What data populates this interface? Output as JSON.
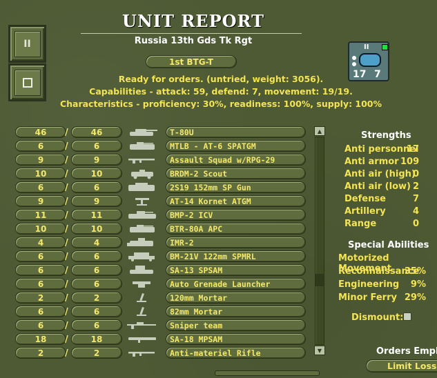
{
  "title": "UNIT REPORT",
  "subtitle": "Russia 13th Gds Tk Rgt",
  "btg_label": "1st BTG-T",
  "status_line": "Ready for orders. (untried, weight: 3056).",
  "capabilities_line": "Capabilities - attack: 59, defend: 7, movement: 19/19.",
  "characteristics_line": "Characteristics - proficiency: 30%, readiness: 100%, supply: 100%",
  "left_buttons": {
    "top_glyph": "II",
    "bottom_glyph": "▢"
  },
  "counter": {
    "size": "II",
    "attack": "17",
    "defend": "7"
  },
  "units": [
    {
      "current": "46",
      "max": "46",
      "name": "T-80U",
      "icon": "tank-icon"
    },
    {
      "current": "6",
      "max": "6",
      "name": "MTLB - AT-6 SPATGM",
      "icon": "apc-icon"
    },
    {
      "current": "9",
      "max": "9",
      "name": "Assault Squad w/RPG-29",
      "icon": "rifle-icon"
    },
    {
      "current": "10",
      "max": "10",
      "name": "BRDM-2 Scout",
      "icon": "armored-car-icon"
    },
    {
      "current": "6",
      "max": "6",
      "name": "2S19 152mm SP Gun",
      "icon": "sp-gun-icon"
    },
    {
      "current": "9",
      "max": "9",
      "name": "AT-14 Kornet ATGM",
      "icon": "atgm-icon"
    },
    {
      "current": "11",
      "max": "11",
      "name": "BMP-2 ICV",
      "icon": "ifv-icon"
    },
    {
      "current": "10",
      "max": "10",
      "name": "BTR-80A APC",
      "icon": "apc-icon"
    },
    {
      "current": "4",
      "max": "4",
      "name": "IMR-2",
      "icon": "engineer-vehicle-icon"
    },
    {
      "current": "6",
      "max": "6",
      "name": "BM-21V 122mm SPMRL",
      "icon": "rocket-truck-icon"
    },
    {
      "current": "6",
      "max": "6",
      "name": "SA-13 SPSAM",
      "icon": "sam-vehicle-icon"
    },
    {
      "current": "6",
      "max": "6",
      "name": "Auto Grenade Launcher",
      "icon": "grenade-launcher-icon"
    },
    {
      "current": "2",
      "max": "2",
      "name": "120mm Mortar",
      "icon": "mortar-icon"
    },
    {
      "current": "6",
      "max": "6",
      "name": "82mm Mortar",
      "icon": "mortar-icon"
    },
    {
      "current": "6",
      "max": "6",
      "name": "Sniper team",
      "icon": "sniper-rifle-icon"
    },
    {
      "current": "18",
      "max": "18",
      "name": "SA-18 MPSAM",
      "icon": "manpad-icon"
    },
    {
      "current": "2",
      "max": "2",
      "name": "Anti-materiel Rifle",
      "icon": "rifle-icon"
    }
  ],
  "strengths": {
    "header": "Strengths",
    "items": [
      {
        "label": "Anti personnel",
        "value": "17"
      },
      {
        "label": "Anti armor",
        "value": "109"
      },
      {
        "label": "Anti air (high)",
        "value": "0"
      },
      {
        "label": "Anti air (low)",
        "value": "2"
      },
      {
        "label": "Defense",
        "value": "7"
      },
      {
        "label": "Artillery",
        "value": "4"
      },
      {
        "label": "Range",
        "value": "0"
      }
    ]
  },
  "special_abilities": {
    "header": "Special Abilities",
    "items": [
      {
        "label": "Motorized Movement",
        "value": ""
      },
      {
        "label": "Reconnaissance",
        "value": "35%"
      },
      {
        "label": "Engineering",
        "value": "9%"
      },
      {
        "label": "Minor Ferry",
        "value": "29%"
      }
    ]
  },
  "dismount_label": "Dismount:",
  "orders_emphasis_label": "Orders Empha",
  "orders_emphasis_value": "Limit Losses"
}
